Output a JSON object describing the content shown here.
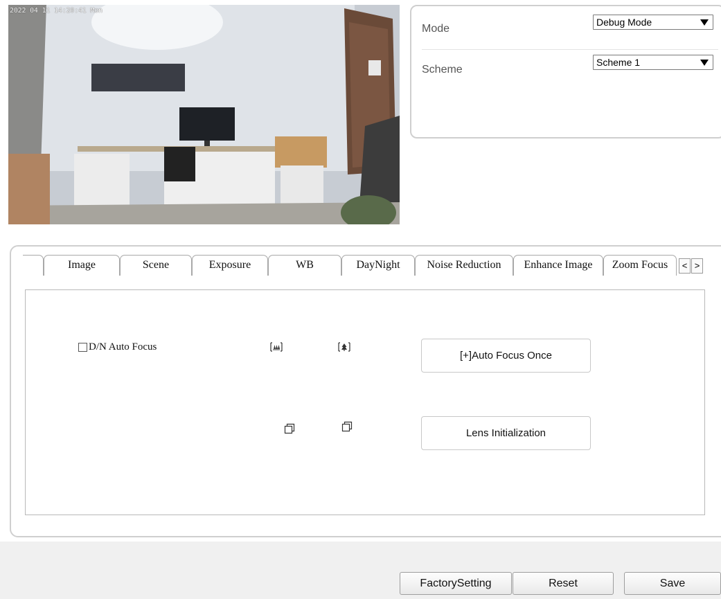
{
  "video": {
    "osd_text": "2022 04 11 14:20:41 Mon"
  },
  "settings": {
    "mode_label": "Mode",
    "mode_value": "Debug Mode",
    "scheme_label": "Scheme",
    "scheme_value": "Scheme 1"
  },
  "tabs": [
    {
      "label": ""
    },
    {
      "label": "Image"
    },
    {
      "label": "Scene"
    },
    {
      "label": "Exposure"
    },
    {
      "label": "WB"
    },
    {
      "label": "DayNight"
    },
    {
      "label": "Noise Reduction"
    },
    {
      "label": "Enhance Image"
    },
    {
      "label": "Zoom Focus"
    }
  ],
  "active_tab": "Zoom Focus",
  "tab_scroll": {
    "prev": "<",
    "next": ">"
  },
  "zoom_focus": {
    "dn_auto_focus_label": "D/N Auto Focus",
    "dn_auto_focus_checked": false,
    "auto_focus_once_label": "[+]Auto Focus Once",
    "lens_init_label": "Lens Initialization"
  },
  "footer": {
    "factory_label": "FactorySetting",
    "reset_label": "Reset",
    "save_label": "Save"
  },
  "icons": {
    "zoom_wide": "zoom-wide-icon",
    "zoom_tele": "zoom-tele-icon",
    "focus_near": "focus-near-icon",
    "focus_far": "focus-far-icon"
  }
}
